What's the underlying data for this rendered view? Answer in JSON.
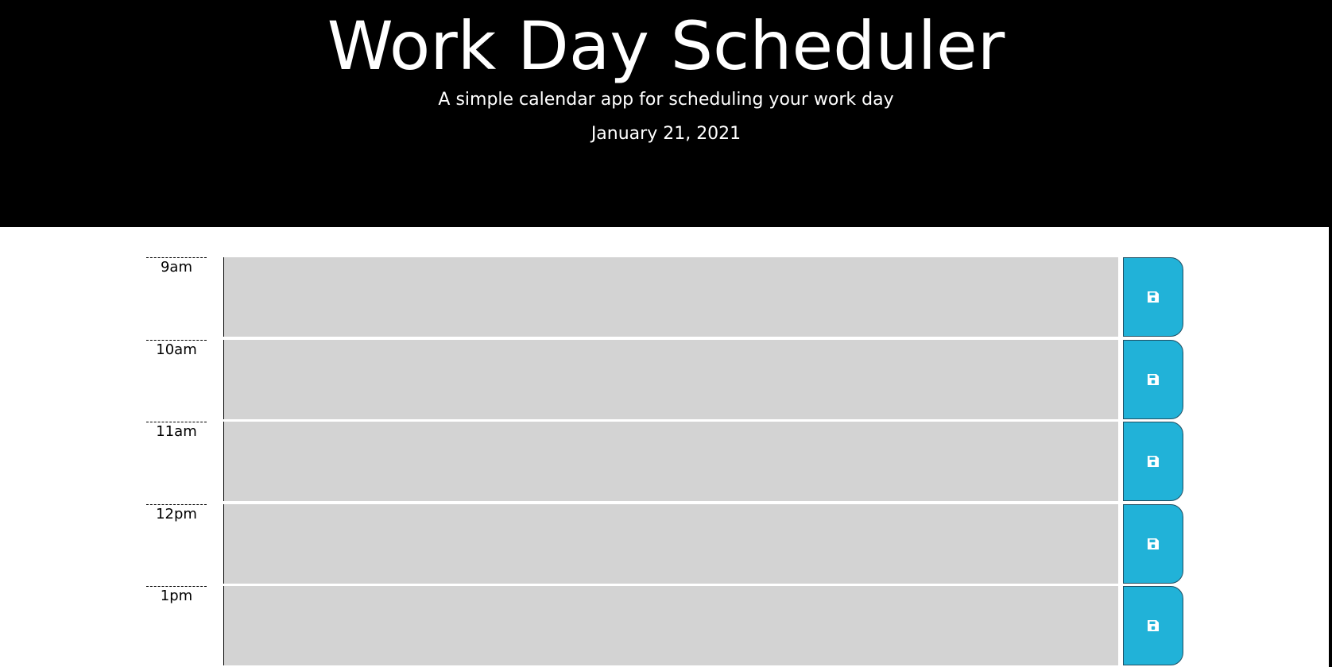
{
  "header": {
    "title": "Work Day Scheduler",
    "subtitle": "A simple calendar app for scheduling your work day",
    "current_day": "January 21, 2021"
  },
  "colors": {
    "header_bg": "#000000",
    "slot_bg": "#d3d3d3",
    "save_button": "#21b2d8"
  },
  "time_blocks": [
    {
      "hour": "9am",
      "text": "",
      "save_icon": "floppy-disk-icon"
    },
    {
      "hour": "10am",
      "text": "",
      "save_icon": "floppy-disk-icon"
    },
    {
      "hour": "11am",
      "text": "",
      "save_icon": "floppy-disk-icon"
    },
    {
      "hour": "12pm",
      "text": "",
      "save_icon": "floppy-disk-icon"
    },
    {
      "hour": "1pm",
      "text": "",
      "save_icon": "floppy-disk-icon"
    }
  ]
}
